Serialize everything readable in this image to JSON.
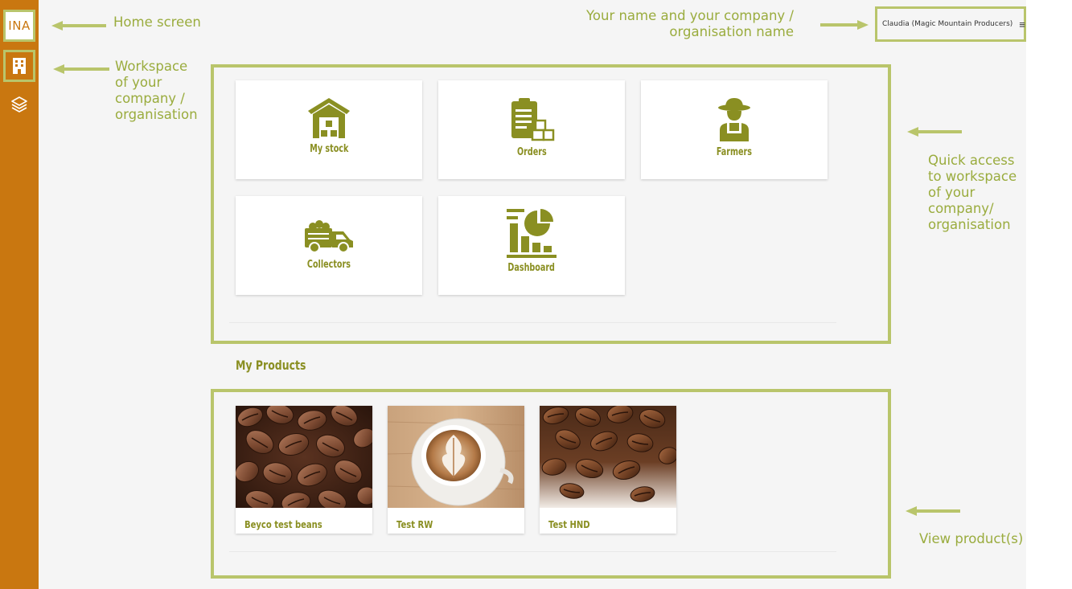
{
  "sidebar": {
    "logo_text": "INA",
    "icons": [
      "building-icon",
      "layers-icon"
    ]
  },
  "header": {
    "user_label": "Claudia (Magic Mountain Producers)",
    "menu_icon": "hamburger-menu-icon"
  },
  "quick_access": {
    "tiles": [
      {
        "label": "My stock",
        "icon": "warehouse-icon"
      },
      {
        "label": "Orders",
        "icon": "clipboard-boxes-icon"
      },
      {
        "label": "Farmers",
        "icon": "farmer-icon"
      },
      {
        "label": "Collectors",
        "icon": "truck-icon"
      },
      {
        "label": "Dashboard",
        "icon": "dashboard-chart-icon"
      }
    ]
  },
  "products": {
    "title": "My Products",
    "items": [
      {
        "name": "Beyco test beans",
        "image": "coffee-beans-photo"
      },
      {
        "name": "Test RW",
        "image": "latte-art-photo"
      },
      {
        "name": "Test HND",
        "image": "coffee-beans-white-photo"
      }
    ]
  },
  "annotations": {
    "home": "Home screen",
    "workspace": [
      "Workspace",
      "of your",
      "company /",
      "organisation"
    ],
    "name": [
      "Your name and your company /",
      "organisation name"
    ],
    "quick": [
      "Quick access",
      "to workspace",
      "of your",
      "company/",
      "organisation"
    ],
    "view": "View product(s)"
  },
  "colors": {
    "sidebar": "#c97710",
    "annotation": "#b9c56b",
    "accent_text": "#8a8f22",
    "icon": "#8a8f22"
  }
}
